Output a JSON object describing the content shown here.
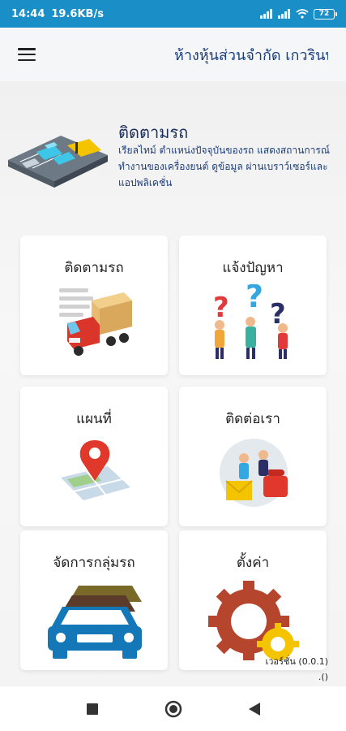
{
  "status_bar": {
    "time": "14:44",
    "speed": "19.6KB/s",
    "battery": "72"
  },
  "app_bar": {
    "title": "ห้างหุ้นส่วนจำกัด เกวรินทร์"
  },
  "hero": {
    "title": "ติดตามรถ",
    "description": "เรียลไทม์ ตำแหน่งปัจจุบันของรถ แสดงสถานการณ์ทำงานของเครื่องยนต์ ดูข้อมูล ผ่านเบราว์เซอร์และแอปพลิเคชั่น"
  },
  "menu": [
    {
      "label": "ติดตามรถ",
      "icon": "truck-icon"
    },
    {
      "label": "แจ้งปัญหา",
      "icon": "question-people-icon"
    },
    {
      "label": "แผนที่",
      "icon": "map-pin-icon"
    },
    {
      "label": "ติดต่อเรา",
      "icon": "contact-phone-icon"
    },
    {
      "label": "จัดการกลุ่มรถ",
      "icon": "car-group-icon"
    },
    {
      "label": "ตั้งค่า",
      "icon": "gear-icon"
    }
  ],
  "version": {
    "line1": "เวอร์ชั่น (0.0.1)",
    "line2": ".()"
  },
  "colors": {
    "status_bar": "#1a8fc7",
    "title": "#1b3d7a",
    "truck_red": "#d9352b",
    "car_blue": "#1478b8"
  }
}
